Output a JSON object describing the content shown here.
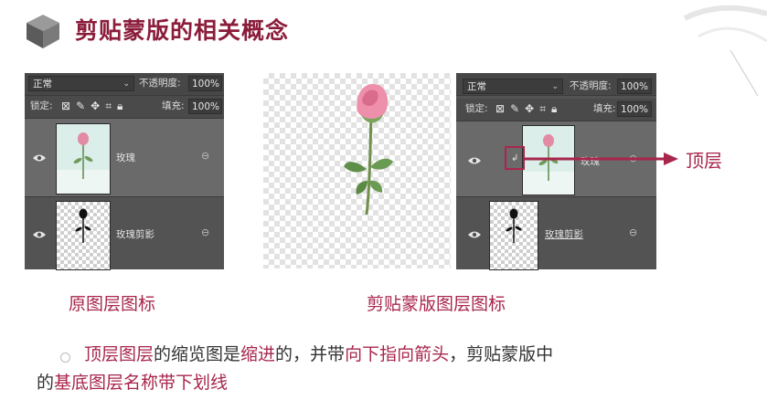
{
  "header": {
    "title": "剪贴蒙版的相关概念"
  },
  "panel_left": {
    "blend_mode": "正常",
    "opacity_label": "不透明度:",
    "opacity_value": "100%",
    "lock_label": "锁定:",
    "fill_label": "填充:",
    "fill_value": "100%",
    "layers": [
      {
        "name": "玫瑰"
      },
      {
        "name": "玫瑰剪影"
      }
    ]
  },
  "panel_right": {
    "blend_mode": "正常",
    "opacity_label": "不透明度:",
    "opacity_value": "100%",
    "lock_label": "锁定:",
    "fill_label": "填充:",
    "fill_value": "100%",
    "layers": [
      {
        "name": "玫瑰"
      },
      {
        "name": "玫瑰剪影"
      }
    ]
  },
  "callout": {
    "label": "顶层"
  },
  "captions": {
    "left": "原图层图标",
    "right": "剪贴蒙版图层图标"
  },
  "body": {
    "p1": "顶层图层",
    "p2": "的缩览图是",
    "p3": "缩进",
    "p4": "的，并带",
    "p5": "向下指向箭头",
    "p6": "，剪贴蒙版中",
    "p7": "的",
    "p8": "基底图层名称带下划线"
  },
  "colors": {
    "accent": "#a8264c",
    "title": "#8b1c3a",
    "panel": "#535353"
  },
  "icons": [
    "cube-icon",
    "eye-icon",
    "link-icon",
    "lock-icon",
    "brush-icon",
    "move-icon",
    "artboard-icon",
    "checkerboard-icon",
    "clip-arrow-icon"
  ]
}
